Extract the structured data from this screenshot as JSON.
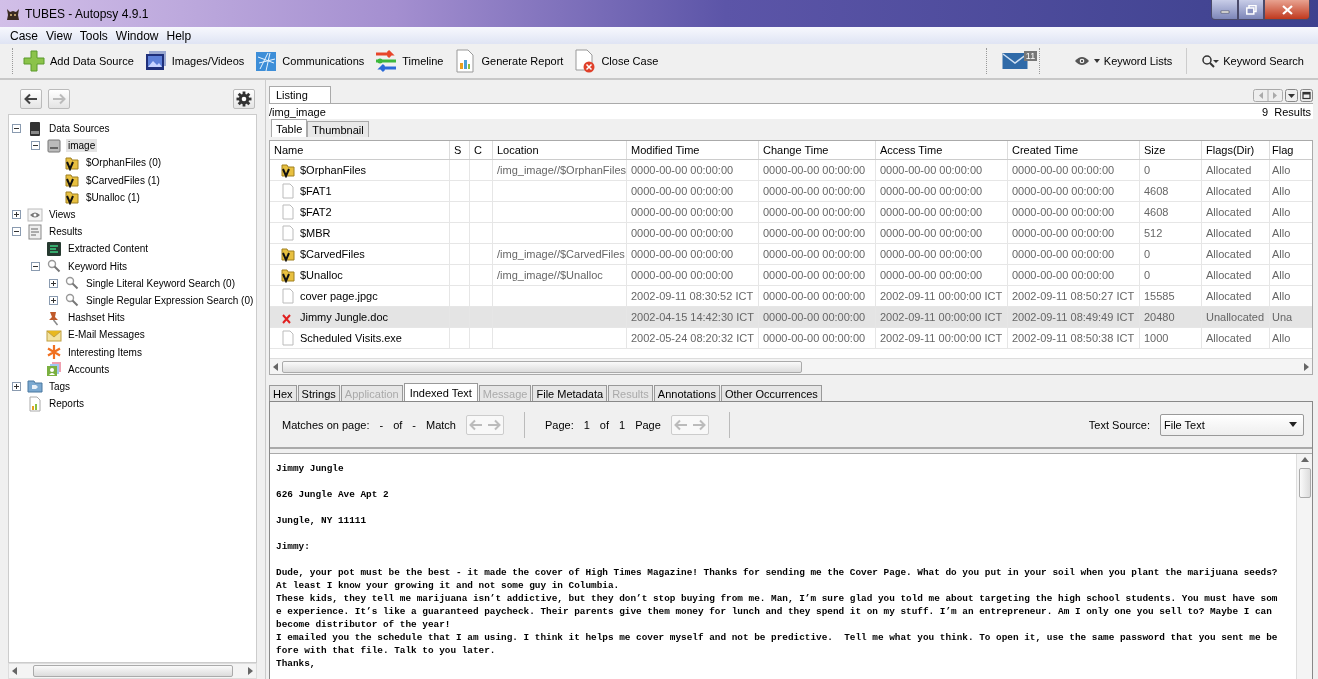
{
  "window": {
    "title": "TUBES - Autopsy 4.9.1"
  },
  "menu": [
    "Case",
    "View",
    "Tools",
    "Window",
    "Help"
  ],
  "toolbar": {
    "items": [
      {
        "kind": "add",
        "label": "Add Data Source"
      },
      {
        "kind": "images",
        "label": "Images/Videos"
      },
      {
        "kind": "communications",
        "label": "Communications"
      },
      {
        "kind": "timeline",
        "label": "Timeline"
      },
      {
        "kind": "report",
        "label": "Generate Report"
      },
      {
        "kind": "close",
        "label": "Close Case"
      }
    ],
    "notification_count": "11",
    "keyword_lists": "Keyword Lists",
    "keyword_search": "Keyword Search"
  },
  "navigation": {
    "back_disabled": false,
    "forward_disabled": true
  },
  "tree": [
    {
      "label": "Data Sources",
      "kind": "drive",
      "expanded": true,
      "selected": false,
      "children": [
        {
          "label": "image",
          "kind": "disk",
          "expanded": true,
          "selected": true,
          "children": [
            {
              "label": "$OrphanFiles (0)",
              "kind": "folder",
              "selected": false
            },
            {
              "label": "$CarvedFiles (1)",
              "kind": "folder",
              "selected": false
            },
            {
              "label": "$Unalloc (1)",
              "kind": "folder",
              "selected": false
            }
          ]
        }
      ]
    },
    {
      "label": "Views",
      "kind": "eye",
      "expanded": false,
      "selected": false
    },
    {
      "label": "Results",
      "kind": "results",
      "expanded": true,
      "selected": false,
      "children": [
        {
          "label": "Extracted Content",
          "kind": "extracted",
          "selected": false
        },
        {
          "label": "Keyword Hits",
          "kind": "search",
          "expanded": true,
          "selected": false,
          "children": [
            {
              "label": "Single Literal Keyword Search (0)",
              "kind": "search",
              "expanded": false,
              "selected": false
            },
            {
              "label": "Single Regular Expression Search (0)",
              "kind": "search",
              "expanded": false,
              "selected": false
            }
          ]
        },
        {
          "label": "Hashset Hits",
          "kind": "pin",
          "selected": false
        },
        {
          "label": "E-Mail Messages",
          "kind": "mail",
          "selected": false
        },
        {
          "label": "Interesting Items",
          "kind": "asterisk",
          "selected": false
        },
        {
          "label": "Accounts",
          "kind": "accounts",
          "selected": false
        }
      ]
    },
    {
      "label": "Tags",
      "kind": "tags",
      "expanded": false,
      "selected": false
    },
    {
      "label": "Reports",
      "kind": "report",
      "selected": false
    }
  ],
  "listing": {
    "tab": "Listing",
    "path": "/img_image",
    "results": "9  Results",
    "views": [
      {
        "label": "Table",
        "selected": true
      },
      {
        "label": "Thumbnail",
        "selected": false
      }
    ],
    "table": {
      "columns": [
        "Name",
        "S",
        "C",
        "Location",
        "Modified Time",
        "Change Time",
        "Access Time",
        "Created Time",
        "Size",
        "Flags(Dir)",
        "Flag"
      ],
      "rows": [
        {
          "kind": "folder",
          "selected": false,
          "cells": [
            "$OrphanFiles",
            null,
            null,
            "/img_image//$OrphanFiles",
            "0000-00-00 00:00:00",
            "0000-00-00 00:00:00",
            "0000-00-00 00:00:00",
            "0000-00-00 00:00:00",
            "0",
            "Allocated",
            "Allo"
          ]
        },
        {
          "kind": "file",
          "selected": false,
          "cells": [
            "$FAT1",
            null,
            null,
            null,
            "0000-00-00 00:00:00",
            "0000-00-00 00:00:00",
            "0000-00-00 00:00:00",
            "0000-00-00 00:00:00",
            "4608",
            "Allocated",
            "Allo"
          ]
        },
        {
          "kind": "file",
          "selected": false,
          "cells": [
            "$FAT2",
            null,
            null,
            null,
            "0000-00-00 00:00:00",
            "0000-00-00 00:00:00",
            "0000-00-00 00:00:00",
            "0000-00-00 00:00:00",
            "4608",
            "Allocated",
            "Allo"
          ]
        },
        {
          "kind": "file",
          "selected": false,
          "cells": [
            "$MBR",
            null,
            null,
            null,
            "0000-00-00 00:00:00",
            "0000-00-00 00:00:00",
            "0000-00-00 00:00:00",
            "0000-00-00 00:00:00",
            "512",
            "Allocated",
            "Allo"
          ]
        },
        {
          "kind": "folder",
          "selected": false,
          "cells": [
            "$CarvedFiles",
            null,
            null,
            "/img_image//$CarvedFiles",
            "0000-00-00 00:00:00",
            "0000-00-00 00:00:00",
            "0000-00-00 00:00:00",
            "0000-00-00 00:00:00",
            "0",
            "Allocated",
            "Allo"
          ]
        },
        {
          "kind": "folder",
          "selected": false,
          "cells": [
            "$Unalloc",
            null,
            null,
            "/img_image//$Unalloc",
            "0000-00-00 00:00:00",
            "0000-00-00 00:00:00",
            "0000-00-00 00:00:00",
            "0000-00-00 00:00:00",
            "0",
            "Allocated",
            "Allo"
          ]
        },
        {
          "kind": "file",
          "selected": false,
          "cells": [
            "cover page.jpgc",
            null,
            null,
            null,
            "2002-09-11 08:30:52 ICT",
            "0000-00-00 00:00:00",
            "2002-09-11 00:00:00 ICT",
            "2002-09-11 08:50:27 ICT",
            "15585",
            "Allocated",
            "Allo"
          ]
        },
        {
          "kind": "deleted",
          "selected": true,
          "cells": [
            "Jimmy Jungle.doc",
            null,
            null,
            null,
            "2002-04-15 14:42:30 ICT",
            "0000-00-00 00:00:00",
            "2002-09-11 00:00:00 ICT",
            "2002-09-11 08:49:49 ICT",
            "20480",
            "Unallocated",
            "Una"
          ]
        },
        {
          "kind": "file",
          "selected": false,
          "cells": [
            "Scheduled Visits.exe",
            null,
            null,
            null,
            "2002-05-24 08:20:32 ICT",
            "0000-00-00 00:00:00",
            "2002-09-11 00:00:00 ICT",
            "2002-09-11 08:50:38 ICT",
            "1000",
            "Allocated",
            "Allo"
          ]
        }
      ]
    }
  },
  "viewer": {
    "tabs": [
      {
        "label": "Hex",
        "selected": false,
        "disabled": false
      },
      {
        "label": "Strings",
        "selected": false,
        "disabled": false
      },
      {
        "label": "Application",
        "selected": false,
        "disabled": true
      },
      {
        "label": "Indexed Text",
        "selected": true,
        "disabled": false
      },
      {
        "label": "Message",
        "selected": false,
        "disabled": true
      },
      {
        "label": "File Metadata",
        "selected": false,
        "disabled": false
      },
      {
        "label": "Results",
        "selected": false,
        "disabled": true
      },
      {
        "label": "Annotations",
        "selected": false,
        "disabled": false
      },
      {
        "label": "Other Occurrences",
        "selected": false,
        "disabled": false
      }
    ],
    "matches": {
      "label": "Matches on page:",
      "current": "-",
      "of": "of",
      "total": "-",
      "unit": "Match",
      "nav_disabled": true
    },
    "pager": {
      "label": "Page:",
      "current": "1",
      "of": "of",
      "total": "1",
      "unit": "Page",
      "nav_disabled": true
    },
    "text_source": {
      "label": "Text Source:",
      "value": "File Text"
    },
    "paragraphs": [
      [
        "Jimmy Jungle"
      ],
      [
        "626 Jungle Ave Apt 2"
      ],
      [
        "Jungle, NY 11111"
      ],
      [
        "Jimmy:"
      ],
      [
        "Dude, your pot must be the best - it made the cover of High Times Magazine! Thanks for sending me the Cover Page. What do you put in your soil when you plant the marijuana seeds?",
        "At least I know your growing it and not some guy in Columbia.",
        "These kids, they tell me marijuana isn’t addictive, but they don’t stop buying from me. Man, I’m sure glad you told me about targeting the high school students. You must have som",
        "e experience. It’s like a guaranteed paycheck. Their parents give them money for lunch and they spend it on my stuff. I’m an entrepreneur. Am I only one you sell to? Maybe I can",
        "become distributor of the year!",
        "I emailed you the schedule that I am using. I think it helps me cover myself and not be predictive.  Tell me what you think. To open it, use the same password that you sent me be",
        "fore with that file. Talk to you later.",
        "Thanks,"
      ]
    ]
  }
}
